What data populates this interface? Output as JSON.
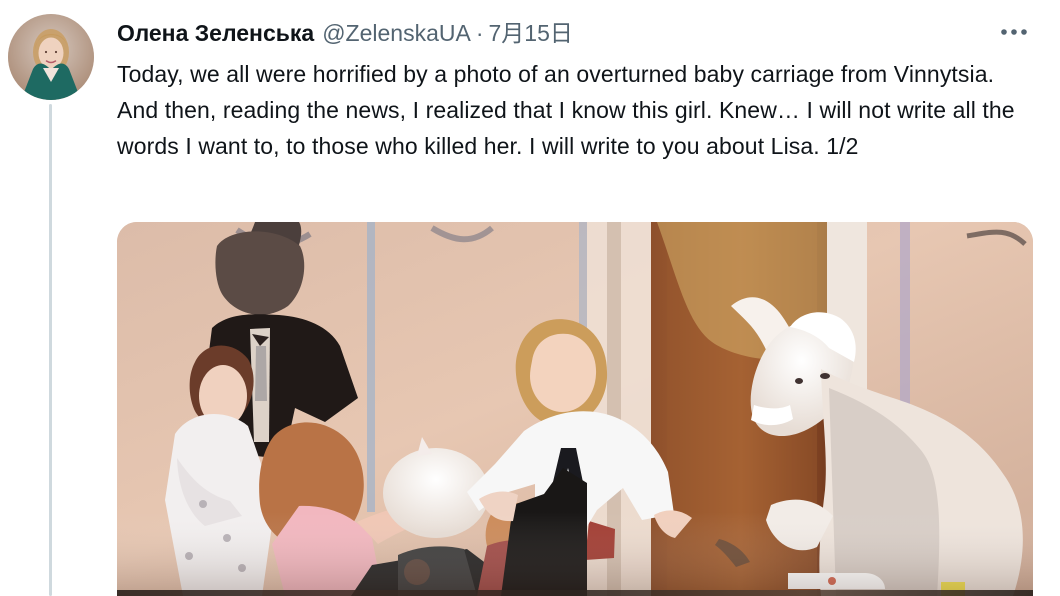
{
  "author": {
    "name": "Олена Зеленська",
    "handle": "@ZelenskaUA",
    "separator": "·",
    "date": "7月15日",
    "more_icon": "more-horizontal-icon"
  },
  "tweet": {
    "text": "Today, we all were horrified by a photo of an overturned baby carriage from Vinnytsia. And then, reading the news, I realized that I know this girl. Knew… I will not write all the words I want to, to those who killed her. I will write to you about Lisa. 1/2"
  },
  "media": {
    "type": "photo"
  },
  "colors": {
    "text": "#0f1419",
    "secondary": "#536471",
    "thread_line": "#cfd9de"
  }
}
